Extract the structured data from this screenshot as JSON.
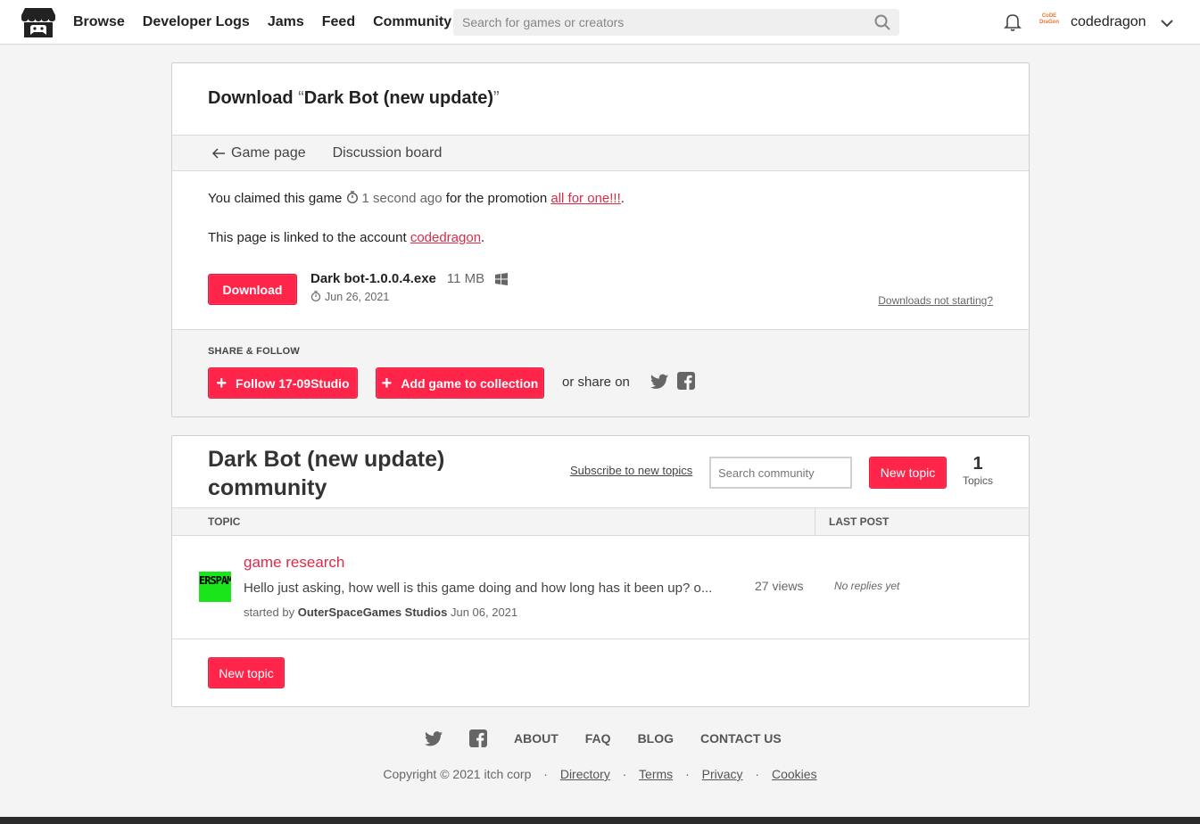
{
  "header": {
    "nav": [
      "Browse",
      "Developer Logs",
      "Jams",
      "Feed",
      "Community"
    ],
    "search_placeholder": "Search for games or creators",
    "username": "codedragon",
    "avatar_text": "CoDE DraGon"
  },
  "download": {
    "title_prefix": "Download",
    "game_title": "Dark Bot (new update)",
    "subnav": {
      "back": "Game page",
      "board": "Discussion board"
    },
    "claimed_prefix": "You claimed this game",
    "claimed_time": "1 second ago",
    "claimed_mid": "for the promotion",
    "promotion": "all for one!!!",
    "linked_prefix": "This page is linked to the account",
    "linked_account": "codedragon",
    "download_label": "Download",
    "file_name": "Dark bot-1.0.0.4.exe",
    "file_size": "11 MB",
    "file_date": "Jun 26, 2021",
    "not_starting": "Downloads not starting?"
  },
  "share": {
    "label": "SHARE & FOLLOW",
    "follow": "Follow 17-09Studio",
    "collection": "Add game to collection",
    "share_on": "or share on"
  },
  "community": {
    "title": "Dark Bot (new update) community",
    "subscribe": "Subscribe to new topics",
    "search_placeholder": "Search community",
    "new_topic": "New topic",
    "topics_count": "1",
    "topics_label": "Topics",
    "col_topic": "TOPIC",
    "col_last_post": "LAST POST",
    "topics": [
      {
        "avatar_text": "ERSPAMES",
        "title": "game research",
        "excerpt": "Hello just asking, how well is this game doing and how long has it been up? o...",
        "started_by": "started by",
        "author": "OuterSpaceGames Studios",
        "date": "Jun 06, 2021",
        "views": "27 views",
        "last_post": "No replies yet"
      }
    ]
  },
  "footer": {
    "links": [
      "ABOUT",
      "FAQ",
      "BLOG",
      "CONTACT US"
    ],
    "copyright": "Copyright © 2021 itch corp",
    "legal": [
      "Directory",
      "Terms",
      "Privacy",
      "Cookies"
    ]
  },
  "colors": {
    "accent": "#ff2449",
    "link": "#da2c49",
    "background": "#f4f4f4"
  }
}
